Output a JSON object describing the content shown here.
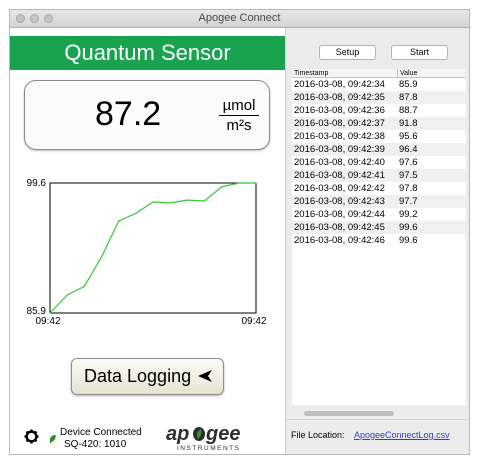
{
  "window": {
    "title": "Apogee Connect"
  },
  "sensor": {
    "title": "Quantum Sensor",
    "reading": "87.2",
    "unit_numerator": "µmol",
    "unit_denominator": "m²s"
  },
  "chart_data": {
    "type": "line",
    "x": [
      "09:42:34",
      "09:42:35",
      "09:42:36",
      "09:42:37",
      "09:42:38",
      "09:42:39",
      "09:42:40",
      "09:42:41",
      "09:42:42",
      "09:42:43",
      "09:42:44",
      "09:42:45",
      "09:42:46"
    ],
    "values": [
      85.9,
      87.8,
      88.7,
      91.8,
      95.6,
      96.4,
      97.6,
      97.5,
      97.8,
      97.7,
      99.2,
      99.6,
      99.6
    ],
    "ylim": [
      85.9,
      99.6
    ],
    "y_ticks": [
      "99.6",
      "85.9"
    ],
    "x_ticks": [
      "09:42",
      "09:42"
    ],
    "title": "",
    "xlabel": "",
    "ylabel": "",
    "grid": false,
    "line_color": "#37c53a"
  },
  "logging": {
    "label": "Data Logging"
  },
  "status": {
    "device_connected": "Device Connected",
    "device_model": "SQ-420: 1010"
  },
  "logo": {
    "brand": "apogee",
    "tagline": "INSTRUMENTS"
  },
  "controls": {
    "setup_label": "Setup",
    "start_label": "Start"
  },
  "table": {
    "headers": [
      "Timestamp",
      "Value"
    ],
    "rows": [
      [
        "2016-03-08, 09:42:34",
        "85.9"
      ],
      [
        "2016-03-08, 09:42:35",
        "87.8"
      ],
      [
        "2016-03-08, 09:42:36",
        "88.7"
      ],
      [
        "2016-03-08, 09:42:37",
        "91.8"
      ],
      [
        "2016-03-08, 09:42:38",
        "95.6"
      ],
      [
        "2016-03-08, 09:42:39",
        "96.4"
      ],
      [
        "2016-03-08, 09:42:40",
        "97.6"
      ],
      [
        "2016-03-08, 09:42:41",
        "97.5"
      ],
      [
        "2016-03-08, 09:42:42",
        "97.8"
      ],
      [
        "2016-03-08, 09:42:43",
        "97.7"
      ],
      [
        "2016-03-08, 09:42:44",
        "99.2"
      ],
      [
        "2016-03-08, 09:42:45",
        "99.6"
      ],
      [
        "2016-03-08, 09:42:46",
        "99.6"
      ]
    ]
  },
  "file": {
    "label": "File Location:",
    "link": "ApogeeConnectLog.csv"
  },
  "colors": {
    "header_green": "#1aa34e",
    "link_blue": "#2a3fc4",
    "leaf_green": "#2e9a2e"
  },
  "icons": [
    "gear-icon",
    "leaf-icon",
    "arrow-left-icon"
  ]
}
